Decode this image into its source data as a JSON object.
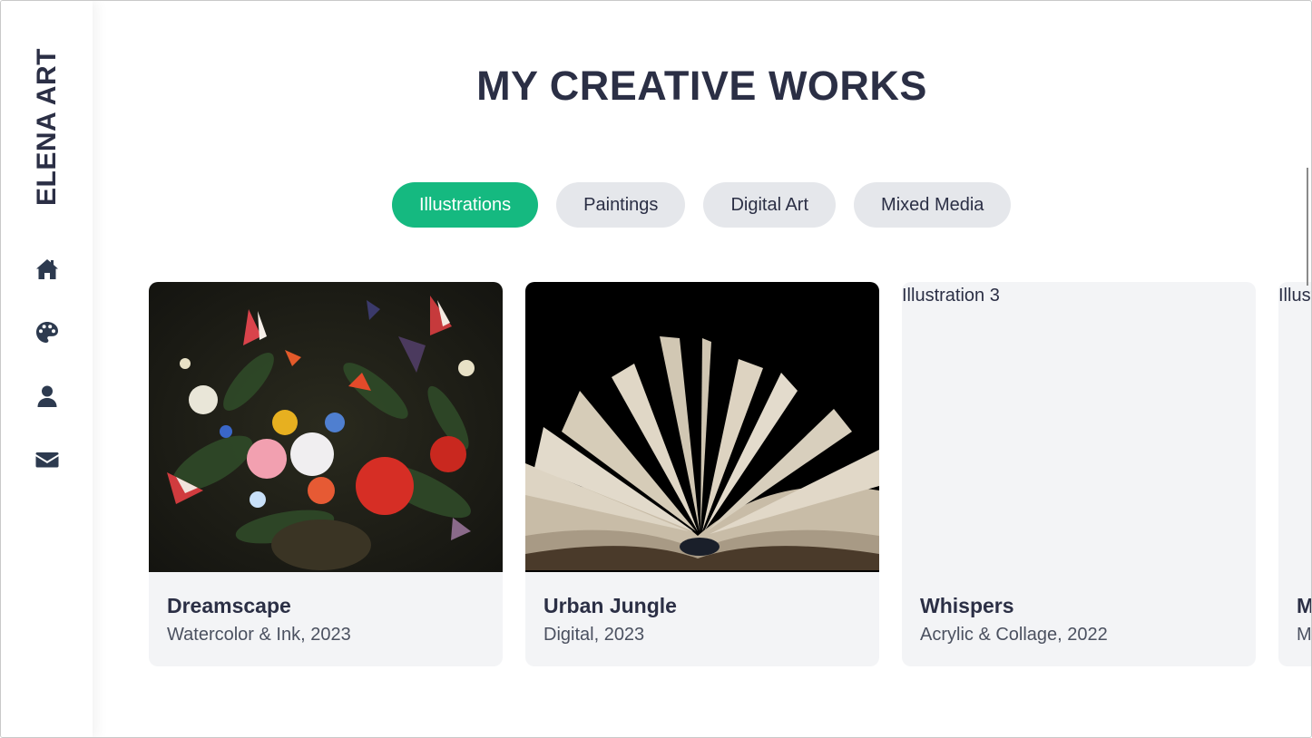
{
  "brand": "ELENA ART",
  "nav": [
    {
      "name": "home-icon",
      "label": "Home"
    },
    {
      "name": "palette-icon",
      "label": "Gallery"
    },
    {
      "name": "user-icon",
      "label": "About"
    },
    {
      "name": "envelope-icon",
      "label": "Contact"
    }
  ],
  "heading": "MY CREATIVE WORKS",
  "filters": [
    "Illustrations",
    "Paintings",
    "Digital Art",
    "Mixed Media"
  ],
  "active_filter": "Illustrations",
  "works": [
    {
      "title": "Dreamscape",
      "meta": "Watercolor & Ink, 2023",
      "image": "flower-still-life",
      "alt": ""
    },
    {
      "title": "Urban Jungle",
      "meta": "Digital, 2023",
      "image": "open-book",
      "alt": ""
    },
    {
      "title": "Whispers",
      "meta": "Acrylic & Collage, 2022",
      "image": "broken",
      "alt": "Illustration 3"
    },
    {
      "title": "M",
      "meta": "M",
      "image": "broken",
      "alt": "Illust"
    }
  ],
  "colors": {
    "accent": "#15b980",
    "text": "#2b2f45",
    "pill": "#e5e7eb",
    "card": "#f3f4f6"
  }
}
